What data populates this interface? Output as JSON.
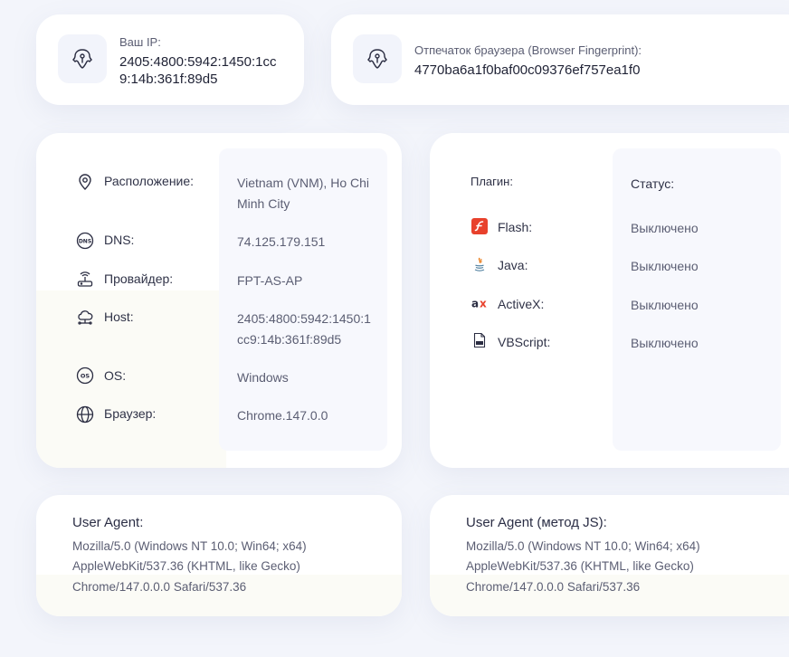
{
  "ip": {
    "label": "Ваш IP:",
    "value": "2405:4800:5942:1450:1cc9:14b:361f:89d5",
    "icon": "fingerprint-icon"
  },
  "fingerprint": {
    "label": "Отпечаток браузера (Browser Fingerprint):",
    "value": "4770ba6a1f0baf00c09376ef757ea1f0",
    "icon": "fingerprint-icon"
  },
  "info": {
    "rows": [
      {
        "label": "Расположение:",
        "value": "Vietnam (VNM), Ho Chi Minh City",
        "icon": "location-pin-icon"
      },
      {
        "label": "DNS:",
        "value": "74.125.179.151",
        "icon": "dns-icon"
      },
      {
        "label": "Провайдер:",
        "value": "FPT-AS-AP",
        "icon": "router-icon"
      },
      {
        "label": "Host:",
        "value": "2405:4800:5942:1450:1cc9:14b:361f:89d5",
        "icon": "cloud-network-icon"
      },
      {
        "label": "OS:",
        "value": "Windows",
        "icon": "os-icon"
      },
      {
        "label": "Браузер:",
        "value": "Chrome.147.0.0",
        "icon": "globe-icon"
      }
    ]
  },
  "plugins": {
    "header_plugin": "Плагин:",
    "header_status": "Статус:",
    "rows": [
      {
        "name": "Flash:",
        "status": "Выключено",
        "icon": "flash-icon"
      },
      {
        "name": "Java:",
        "status": "Выключено",
        "icon": "java-icon"
      },
      {
        "name": "ActiveX:",
        "status": "Выключено",
        "icon": "activex-icon"
      },
      {
        "name": "VBScript:",
        "status": "Выключено",
        "icon": "vbscript-file-icon"
      }
    ]
  },
  "useragent": {
    "title": "User Agent:",
    "lines": [
      "Mozilla/5.0 (Windows NT 10.0; Win64; x64)",
      "AppleWebKit/537.36 (KHTML, like Gecko)",
      "Chrome/147.0.0.0 Safari/537.36"
    ]
  },
  "useragent_js": {
    "title": "User Agent (метод JS):",
    "lines": [
      "Mozilla/5.0 (Windows NT 10.0; Win64; x64)",
      "AppleWebKit/537.36 (KHTML, like Gecko)",
      "Chrome/147.0.0.0 Safari/537.36"
    ]
  },
  "colors": {
    "accent": "#2b2d42",
    "flash": "#e8412c",
    "java": "#e76f00",
    "panel": "#f7f8fd"
  }
}
